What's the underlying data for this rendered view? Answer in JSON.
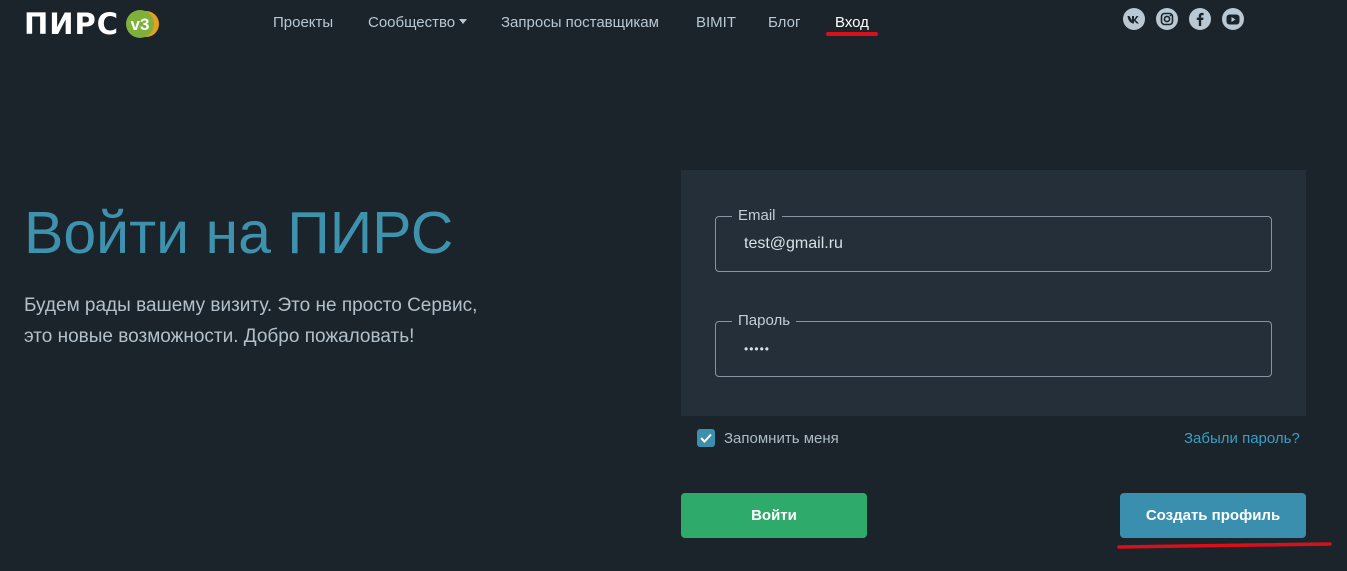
{
  "header": {
    "logo": {
      "text": "ПИРС",
      "badge": "v3"
    },
    "nav": [
      {
        "label": "Проекты"
      },
      {
        "label": "Сообщество"
      },
      {
        "label": "Запросы поставщикам"
      },
      {
        "label": "BIMIT"
      },
      {
        "label": "Блог"
      },
      {
        "label": "Вход"
      }
    ],
    "socials": [
      "vk-icon",
      "instagram-icon",
      "facebook-icon",
      "youtube-icon"
    ]
  },
  "hero": {
    "title": "Войти на ПИРС",
    "subtitle_line1": "Будем рады вашему визиту. Это не просто Сервис,",
    "subtitle_line2": "это новые возможности. Добро пожаловать!"
  },
  "form": {
    "email": {
      "label": "Email",
      "value": "test@gmail.ru"
    },
    "password": {
      "label": "Пароль",
      "value": "•••••"
    },
    "remember": {
      "label": "Запомнить меня",
      "checked": true
    },
    "forgot": "Забыли пароль?",
    "login_button": "Войти",
    "create_button": "Создать профиль"
  },
  "colors": {
    "background": "#1b242b",
    "panel": "#252f39",
    "accent": "#3b8fae",
    "success": "#2eaa6b",
    "annotation_red": "#d8101c"
  }
}
